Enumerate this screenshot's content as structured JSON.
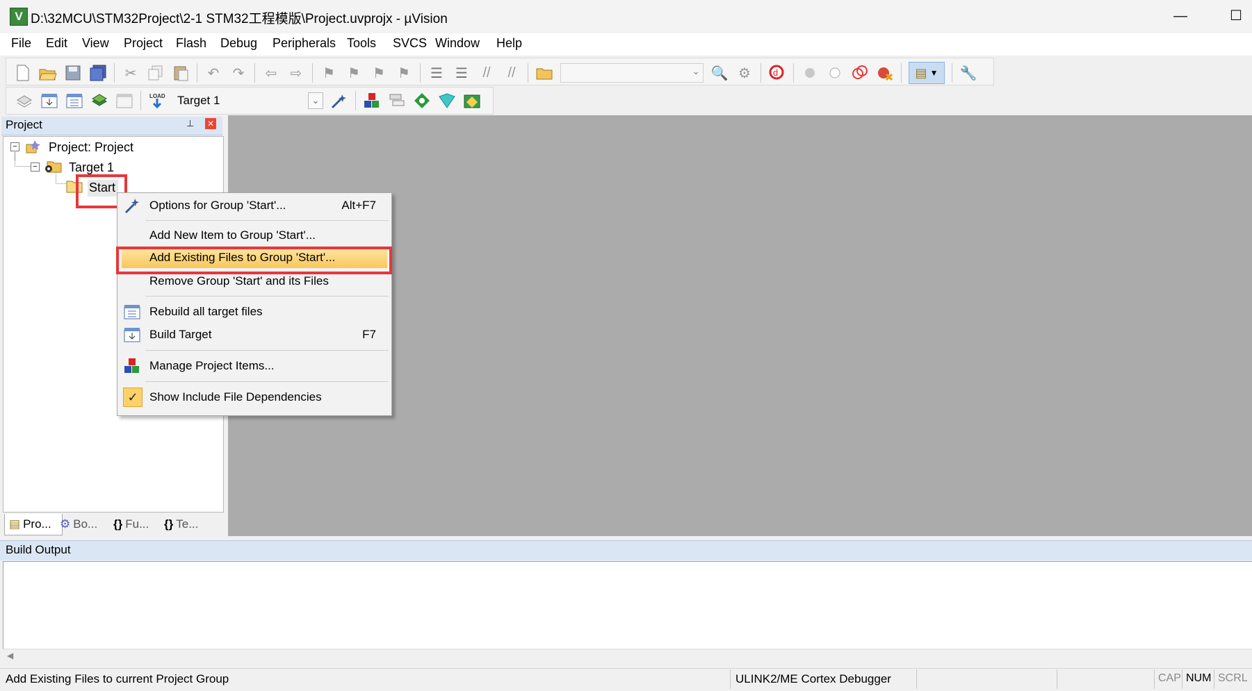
{
  "window": {
    "title": "D:\\32MCU\\STM32Project\\2-1 STM32工程模版\\Project.uvprojx - µVision",
    "app_icon_letter": "V",
    "minimize_glyph": "—",
    "maximize_glyph": "☐"
  },
  "menubar": [
    "File",
    "Edit",
    "View",
    "Project",
    "Flash",
    "Debug",
    "Peripherals",
    "Tools",
    "SVCS",
    "Window",
    "Help"
  ],
  "toolbar2": {
    "target_select": "Target 1"
  },
  "project_panel": {
    "title": "Project",
    "pin_glyph": "📌",
    "close_glyph": "✕",
    "tree": {
      "root_label": "Project: Project",
      "target_label": "Target 1",
      "group_label": "Start"
    },
    "tabs": [
      "Pro...",
      "Bo...",
      "Fu...",
      "Te..."
    ],
    "tab_icons": [
      "▤",
      "⚙",
      "{}",
      "{}"
    ]
  },
  "context_menu": {
    "items": [
      {
        "label": "Options for Group 'Start'...",
        "shortcut": "Alt+F7",
        "icon": "magic-wand-icon"
      },
      {
        "label": "Add New  Item to Group 'Start'...",
        "shortcut": "",
        "icon": ""
      },
      {
        "label": "Add Existing Files to Group 'Start'...",
        "shortcut": "",
        "icon": "",
        "highlighted": true
      },
      {
        "label": "Remove Group 'Start' and its Files",
        "shortcut": "",
        "icon": ""
      },
      {
        "label": "Rebuild all target files",
        "shortcut": "",
        "icon": "rebuild-icon"
      },
      {
        "label": "Build Target",
        "shortcut": "F7",
        "icon": "build-icon"
      },
      {
        "label": "Manage Project Items...",
        "shortcut": "",
        "icon": "manage-items-icon"
      },
      {
        "label": "Show Include File Dependencies",
        "shortcut": "",
        "icon": "checkmark-icon",
        "checked": true
      }
    ]
  },
  "build_output": {
    "title": "Build Output"
  },
  "statusbar": {
    "message": "Add Existing Files to current Project Group",
    "debugger": "ULINK2/ME Cortex Debugger",
    "cap": "CAP",
    "num": "NUM",
    "scrl": "SCRL"
  },
  "colors": {
    "highlight_box": "#e8373b",
    "menu_highlight": "#fbd26a",
    "workspace": "#ababab",
    "panel_header": "#dbe6f4"
  }
}
